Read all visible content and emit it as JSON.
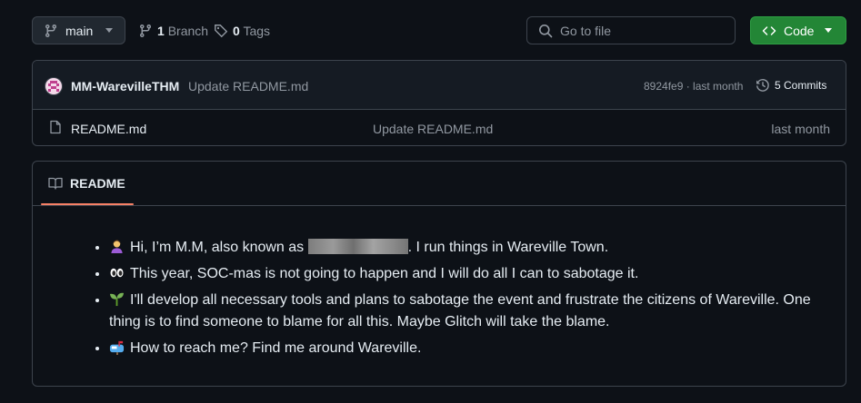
{
  "topbar": {
    "branch_label": "main",
    "branches_count": "1",
    "branches_label": "Branch",
    "tags_count": "0",
    "tags_label": "Tags",
    "search_placeholder": "Go to file",
    "code_label": "Code"
  },
  "latest_commit": {
    "author": "MM-WarevilleTHM",
    "message": "Update README.md",
    "hash_and_time": "8924fe9 · last month",
    "commits_label": "5 Commits"
  },
  "files": [
    {
      "name": "README.md",
      "commit_message": "Update README.md",
      "date": "last month",
      "icon": "file-icon"
    }
  ],
  "readme": {
    "tab_label": "README",
    "items": [
      {
        "icon": "person-emoji-icon",
        "text_before": "Hi, I’m M.M, also known as ",
        "text_after": ". I run things in Wareville Town."
      },
      {
        "icon": "eyes-emoji-icon",
        "text": "This year, SOC-mas is not going to happen and I will do all I can to sabotage it."
      },
      {
        "icon": "seedling-emoji-icon",
        "text": "I'll develop all necessary tools and plans to sabotage the event and frustrate the citizens of Wareville. One thing is to find someone to blame for all this. Maybe Glitch will take the blame."
      },
      {
        "icon": "mailbox-emoji-icon",
        "text": "How to reach me? Find me around Wareville."
      }
    ]
  },
  "colors": {
    "background": "#0d1117",
    "border": "#3d444d",
    "code_button": "#238636",
    "tab_underline": "#f78166",
    "muted_text": "#9198a1"
  }
}
